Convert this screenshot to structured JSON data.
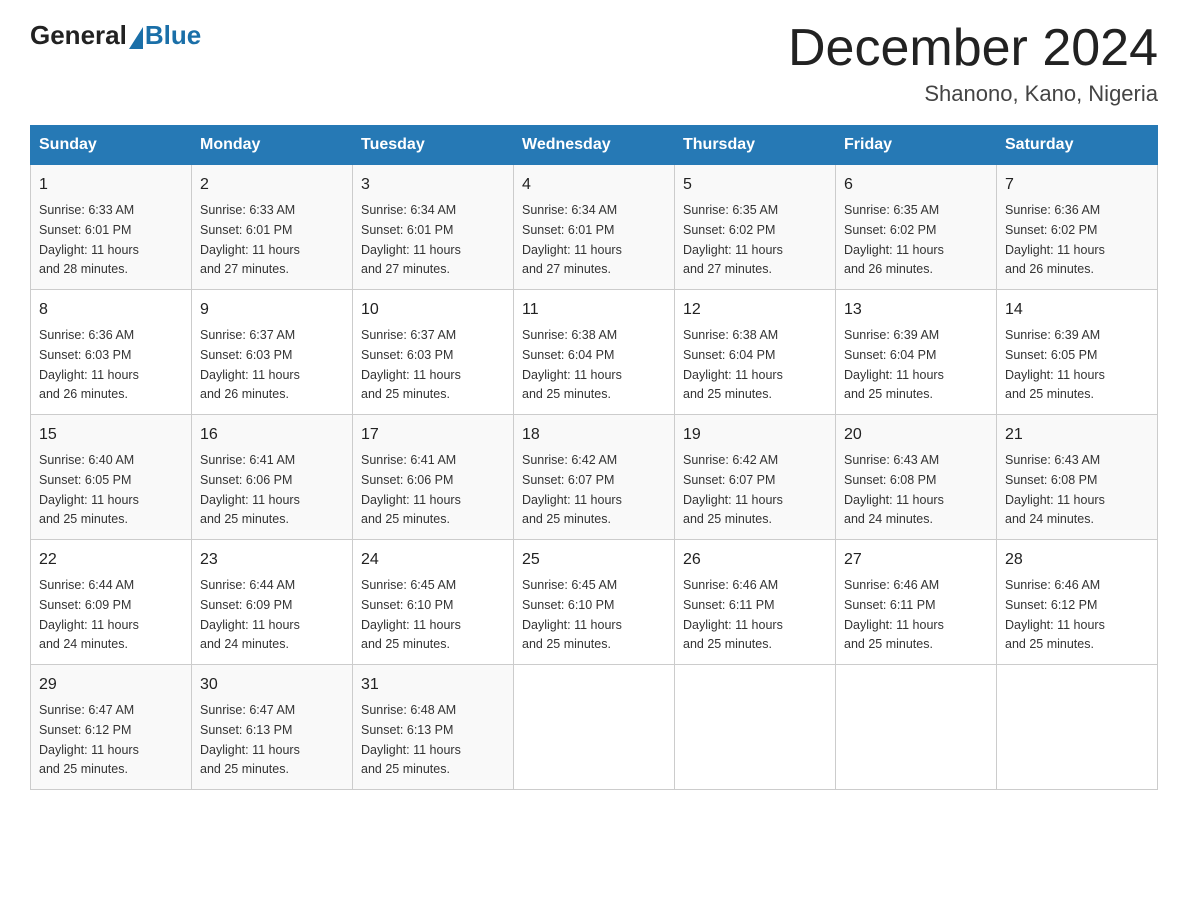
{
  "logo": {
    "general": "General",
    "blue": "Blue"
  },
  "header": {
    "month_title": "December 2024",
    "location": "Shanono, Kano, Nigeria"
  },
  "days_of_week": [
    "Sunday",
    "Monday",
    "Tuesday",
    "Wednesday",
    "Thursday",
    "Friday",
    "Saturday"
  ],
  "weeks": [
    [
      {
        "day": "1",
        "sunrise": "6:33 AM",
        "sunset": "6:01 PM",
        "daylight": "11 hours and 28 minutes."
      },
      {
        "day": "2",
        "sunrise": "6:33 AM",
        "sunset": "6:01 PM",
        "daylight": "11 hours and 27 minutes."
      },
      {
        "day": "3",
        "sunrise": "6:34 AM",
        "sunset": "6:01 PM",
        "daylight": "11 hours and 27 minutes."
      },
      {
        "day": "4",
        "sunrise": "6:34 AM",
        "sunset": "6:01 PM",
        "daylight": "11 hours and 27 minutes."
      },
      {
        "day": "5",
        "sunrise": "6:35 AM",
        "sunset": "6:02 PM",
        "daylight": "11 hours and 27 minutes."
      },
      {
        "day": "6",
        "sunrise": "6:35 AM",
        "sunset": "6:02 PM",
        "daylight": "11 hours and 26 minutes."
      },
      {
        "day": "7",
        "sunrise": "6:36 AM",
        "sunset": "6:02 PM",
        "daylight": "11 hours and 26 minutes."
      }
    ],
    [
      {
        "day": "8",
        "sunrise": "6:36 AM",
        "sunset": "6:03 PM",
        "daylight": "11 hours and 26 minutes."
      },
      {
        "day": "9",
        "sunrise": "6:37 AM",
        "sunset": "6:03 PM",
        "daylight": "11 hours and 26 minutes."
      },
      {
        "day": "10",
        "sunrise": "6:37 AM",
        "sunset": "6:03 PM",
        "daylight": "11 hours and 25 minutes."
      },
      {
        "day": "11",
        "sunrise": "6:38 AM",
        "sunset": "6:04 PM",
        "daylight": "11 hours and 25 minutes."
      },
      {
        "day": "12",
        "sunrise": "6:38 AM",
        "sunset": "6:04 PM",
        "daylight": "11 hours and 25 minutes."
      },
      {
        "day": "13",
        "sunrise": "6:39 AM",
        "sunset": "6:04 PM",
        "daylight": "11 hours and 25 minutes."
      },
      {
        "day": "14",
        "sunrise": "6:39 AM",
        "sunset": "6:05 PM",
        "daylight": "11 hours and 25 minutes."
      }
    ],
    [
      {
        "day": "15",
        "sunrise": "6:40 AM",
        "sunset": "6:05 PM",
        "daylight": "11 hours and 25 minutes."
      },
      {
        "day": "16",
        "sunrise": "6:41 AM",
        "sunset": "6:06 PM",
        "daylight": "11 hours and 25 minutes."
      },
      {
        "day": "17",
        "sunrise": "6:41 AM",
        "sunset": "6:06 PM",
        "daylight": "11 hours and 25 minutes."
      },
      {
        "day": "18",
        "sunrise": "6:42 AM",
        "sunset": "6:07 PM",
        "daylight": "11 hours and 25 minutes."
      },
      {
        "day": "19",
        "sunrise": "6:42 AM",
        "sunset": "6:07 PM",
        "daylight": "11 hours and 25 minutes."
      },
      {
        "day": "20",
        "sunrise": "6:43 AM",
        "sunset": "6:08 PM",
        "daylight": "11 hours and 24 minutes."
      },
      {
        "day": "21",
        "sunrise": "6:43 AM",
        "sunset": "6:08 PM",
        "daylight": "11 hours and 24 minutes."
      }
    ],
    [
      {
        "day": "22",
        "sunrise": "6:44 AM",
        "sunset": "6:09 PM",
        "daylight": "11 hours and 24 minutes."
      },
      {
        "day": "23",
        "sunrise": "6:44 AM",
        "sunset": "6:09 PM",
        "daylight": "11 hours and 24 minutes."
      },
      {
        "day": "24",
        "sunrise": "6:45 AM",
        "sunset": "6:10 PM",
        "daylight": "11 hours and 25 minutes."
      },
      {
        "day": "25",
        "sunrise": "6:45 AM",
        "sunset": "6:10 PM",
        "daylight": "11 hours and 25 minutes."
      },
      {
        "day": "26",
        "sunrise": "6:46 AM",
        "sunset": "6:11 PM",
        "daylight": "11 hours and 25 minutes."
      },
      {
        "day": "27",
        "sunrise": "6:46 AM",
        "sunset": "6:11 PM",
        "daylight": "11 hours and 25 minutes."
      },
      {
        "day": "28",
        "sunrise": "6:46 AM",
        "sunset": "6:12 PM",
        "daylight": "11 hours and 25 minutes."
      }
    ],
    [
      {
        "day": "29",
        "sunrise": "6:47 AM",
        "sunset": "6:12 PM",
        "daylight": "11 hours and 25 minutes."
      },
      {
        "day": "30",
        "sunrise": "6:47 AM",
        "sunset": "6:13 PM",
        "daylight": "11 hours and 25 minutes."
      },
      {
        "day": "31",
        "sunrise": "6:48 AM",
        "sunset": "6:13 PM",
        "daylight": "11 hours and 25 minutes."
      },
      null,
      null,
      null,
      null
    ]
  ],
  "labels": {
    "sunrise": "Sunrise:",
    "sunset": "Sunset:",
    "daylight": "Daylight:"
  }
}
